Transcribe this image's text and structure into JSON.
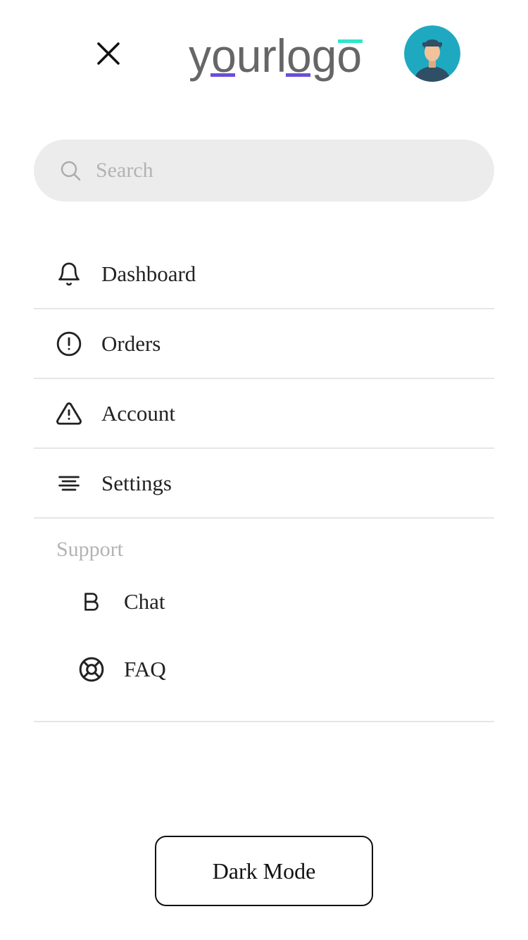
{
  "header": {
    "close_icon": "close-icon",
    "logo_text": "yourlogo",
    "avatar_icon": "user-avatar"
  },
  "search": {
    "placeholder": "Search",
    "value": "",
    "icon": "search-icon"
  },
  "nav": {
    "items": [
      {
        "label": "Dashboard",
        "icon": "bell-icon"
      },
      {
        "label": "Orders",
        "icon": "alert-circle-icon"
      },
      {
        "label": "Account",
        "icon": "alert-triangle-icon"
      },
      {
        "label": "Settings",
        "icon": "align-center-icon"
      }
    ]
  },
  "support": {
    "heading": "Support",
    "items": [
      {
        "label": "Chat",
        "icon": "bold-icon"
      },
      {
        "label": "FAQ",
        "icon": "life-buoy-icon"
      }
    ]
  },
  "footer": {
    "dark_mode_label": "Dark Mode"
  },
  "colors": {
    "logo_text": "#666666",
    "logo_accent_purple": "#6a4fd8",
    "logo_accent_teal": "#2ee6c8",
    "avatar_bg": "#1fa9c0",
    "search_bg": "#ececec",
    "divider": "#e6e6e6",
    "muted_text": "#b3b3b3"
  }
}
